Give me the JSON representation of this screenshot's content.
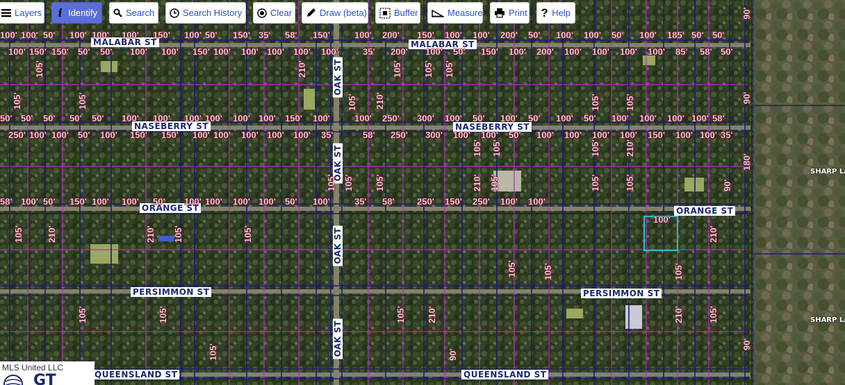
{
  "toolbar": {
    "buttons": [
      {
        "label": "Layers",
        "icon": "menu-icon"
      },
      {
        "label": "Identify",
        "icon": "info-icon",
        "active": true
      },
      {
        "label": "Search",
        "icon": "search-icon"
      },
      {
        "label": "Search History",
        "icon": "clock-icon"
      },
      {
        "label": "Clear",
        "icon": "clear-icon"
      },
      {
        "label": "Draw (beta)",
        "icon": "pencil-icon"
      },
      {
        "label": "Buffer",
        "icon": "buffer-icon"
      },
      {
        "label": "Measure",
        "icon": "ruler-icon"
      },
      {
        "label": "Print",
        "icon": "printer-icon"
      },
      {
        "label": "Help",
        "icon": "help-icon"
      }
    ]
  },
  "streets": {
    "malabar_1": "MALABAR ST",
    "malabar_2": "MALABAR ST",
    "naseberry_1": "NASEBERRY ST",
    "naseberry_2": "NASEBERRY ST",
    "orange_1": "ORANGE ST",
    "orange_2": "ORANGE ST",
    "persimmon_1": "PERSIMMON ST",
    "persimmon_2": "PERSIMMON ST",
    "queensland_1": "QUEENSLAND ST",
    "queensland_2": "QUEENSLAND ST",
    "oak": "OAK ST",
    "sharp_1": "SHARP LA",
    "sharp_2": "SHARP LA"
  },
  "dimensions": [
    "100'",
    "100'",
    "50'",
    "100'",
    "100'",
    "100'",
    "150'",
    "100'",
    "50'",
    "150'",
    "35'",
    "58'",
    "150'",
    "100'",
    "200'",
    "150'",
    "100'",
    "100'",
    "200'",
    "50'",
    "100'",
    "100'",
    "50'",
    "100'",
    "185'",
    "50'",
    "50'",
    "100'",
    "150'",
    "150'",
    "50'",
    "50'",
    "100'",
    "100'",
    "150'",
    "100'",
    "100'",
    "100'",
    "100'",
    "100'",
    "35'",
    "200'",
    "100'",
    "50'",
    "150'",
    "100'",
    "200'",
    "100'",
    "100'",
    "100'",
    "100'",
    "85'",
    "58'",
    "50'",
    "50'",
    "50'",
    "50'",
    "50'",
    "50'",
    "100'",
    "100'",
    "100'",
    "100'",
    "100'",
    "100'",
    "150'",
    "100'",
    "100'",
    "250'",
    "300'",
    "100'",
    "50'",
    "100'",
    "50'",
    "100'",
    "50'",
    "100'",
    "100'",
    "100'",
    "100'",
    "58'",
    "250'",
    "100'",
    "100'",
    "50'",
    "100'",
    "150'",
    "150'",
    "100'",
    "100'",
    "100'",
    "100'",
    "100'",
    "35'",
    "58'",
    "250'",
    "300'",
    "100'",
    "100'",
    "50'",
    "100'",
    "100'",
    "100'",
    "100'",
    "150'",
    "100'",
    "100'",
    "35'",
    "58'",
    "100'",
    "50'",
    "150'",
    "100'",
    "100'",
    "50'",
    "100'",
    "100'",
    "100'",
    "100'",
    "50'",
    "100'",
    "35'",
    "58'",
    "250'",
    "150'",
    "250'",
    "100'",
    "100'",
    "105'",
    "105'",
    "105'",
    "210'",
    "105'",
    "105'",
    "105'",
    "210'",
    "105'",
    "105'",
    "105'",
    "90'",
    "105'",
    "210'",
    "105'",
    "105'",
    "105'",
    "90'",
    "180'",
    "90'",
    "210'",
    "105'",
    "105'",
    "105'",
    "90'",
    "105'",
    "105'",
    "210'",
    "105'",
    "105'",
    "105'",
    "105'",
    "210'",
    "210'",
    "105'",
    "105'",
    "105'",
    "105'",
    "105'",
    "210'",
    "105'",
    "105'",
    "210'",
    "90'"
  ],
  "highlight_parcel_label": "100'",
  "credit": {
    "text": "MLS United LLC",
    "logo_text": "GT"
  },
  "colors": {
    "parcel_line": "#1a1a6e",
    "lot_line": "#b02fc2",
    "road": "#8a8a7a",
    "highlight": "#2fb8d8",
    "active_button": "#5a6fd8",
    "button_text": "#2b4ec6"
  }
}
